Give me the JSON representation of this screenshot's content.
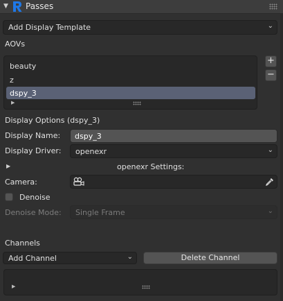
{
  "panel": {
    "title": "Passes",
    "logo_letter": "R",
    "brand_color": "#1e78e8"
  },
  "add_display_template": {
    "label": "Add Display Template"
  },
  "aovs": {
    "heading": "AOVs",
    "items": [
      {
        "label": "beauty",
        "selected": false
      },
      {
        "label": "z",
        "selected": false
      },
      {
        "label": "dspy_3",
        "selected": true
      }
    ],
    "add_symbol": "+",
    "remove_symbol": "−"
  },
  "display_options": {
    "heading": "Display Options (dspy_3)",
    "display_name_label": "Display Name:",
    "display_name_value": "dspy_3",
    "display_driver_label": "Display Driver:",
    "display_driver_value": "openexr",
    "settings_label": "openexr Settings:",
    "camera_label": "Camera:",
    "denoise_label": "Denoise",
    "denoise_checked": false,
    "denoise_mode_label": "Denoise Mode:",
    "denoise_mode_value": "Single Frame"
  },
  "channels": {
    "heading": "Channels",
    "add_channel_label": "Add Channel",
    "delete_channel_label": "Delete Channel"
  }
}
